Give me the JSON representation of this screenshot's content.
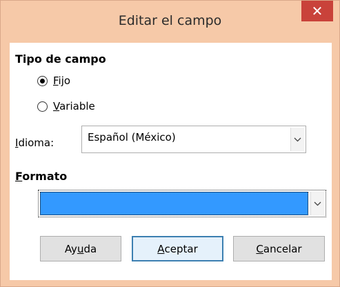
{
  "window": {
    "title": "Editar el campo",
    "close_glyph": "✕"
  },
  "field_type": {
    "heading": "Tipo de campo",
    "options": [
      {
        "mnemonic": "F",
        "rest": "ijo",
        "selected": true
      },
      {
        "mnemonic": "V",
        "rest": "ariable",
        "selected": false
      }
    ]
  },
  "language": {
    "label_mnemonic": "I",
    "label_rest": "dioma:",
    "value": "Español (México)"
  },
  "format": {
    "heading_mnemonic": "F",
    "heading_rest": "ormato",
    "value": "",
    "highlight_color": "#3399ff"
  },
  "buttons": {
    "help": {
      "before": "Ay",
      "mnemonic": "u",
      "after": "da"
    },
    "ok": {
      "before": "",
      "mnemonic": "A",
      "after": "ceptar"
    },
    "cancel": {
      "before": "",
      "mnemonic": "C",
      "after": "ancelar"
    }
  },
  "colors": {
    "titlebar": "#f6c9a8",
    "close": "#c9423a",
    "accent": "#3c7fb1"
  }
}
